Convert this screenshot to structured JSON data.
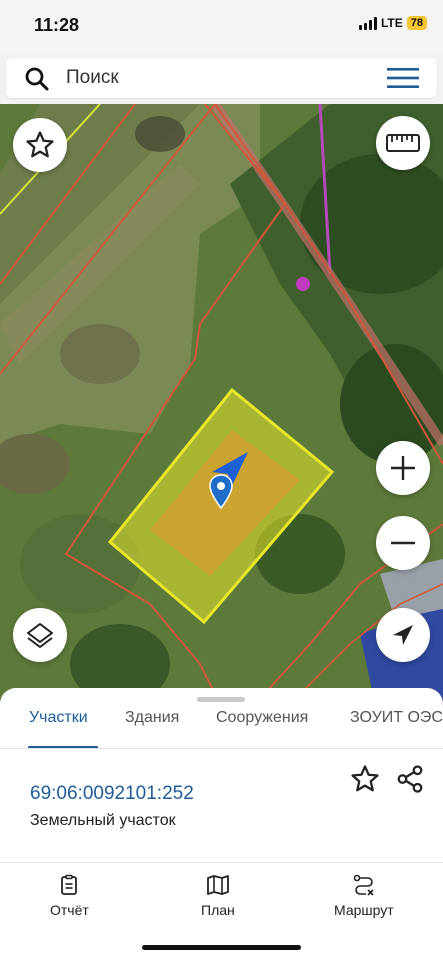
{
  "status_bar": {
    "time": "11:28",
    "network": "LTE",
    "battery": "78"
  },
  "search": {
    "placeholder": "Поиск"
  },
  "map": {
    "icons": [
      "star-icon",
      "ruler-icon",
      "zoom-in-icon",
      "zoom-out-icon",
      "layers-icon",
      "locate-icon",
      "location-pin-icon",
      "navigation-arrow-icon"
    ],
    "colors": {
      "parcel_highlight": "#e6e62a",
      "boundary": "#d0583c",
      "accent": "#1f5d99"
    }
  },
  "sheet": {
    "tabs": [
      {
        "label": "Участки",
        "active": true
      },
      {
        "label": "Здания",
        "active": false
      },
      {
        "label": "Сооружения",
        "active": false
      },
      {
        "label": "ЗОУИТ ОЭС",
        "active": false
      }
    ],
    "parcel": {
      "cadastral_number": "69:06:0092101:252",
      "type": "Земельный участок"
    }
  },
  "bottom_nav": {
    "items": [
      {
        "label": "Отчёт",
        "icon": "report-icon"
      },
      {
        "label": "План",
        "icon": "map-plan-icon"
      },
      {
        "label": "Маршрут",
        "icon": "route-icon"
      }
    ]
  }
}
